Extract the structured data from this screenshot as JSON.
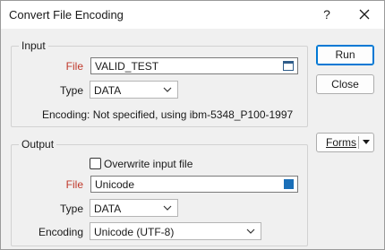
{
  "window": {
    "title": "Convert File Encoding",
    "help_glyph": "?"
  },
  "input_group": {
    "legend": "Input",
    "file_label": "File",
    "file_value": "VALID_TEST",
    "type_label": "Type",
    "type_value": "DATA",
    "encoding_text": "Encoding: Not specified, using ibm-5348_P100-1997"
  },
  "output_group": {
    "legend": "Output",
    "overwrite_label": "Overwrite input file",
    "overwrite_checked": false,
    "file_label": "File",
    "file_value": "Unicode",
    "type_label": "Type",
    "type_value": "DATA",
    "encoding_label": "Encoding",
    "encoding_value": "Unicode (UTF-8)"
  },
  "buttons": {
    "run": "Run",
    "close": "Close",
    "forms": "Forms"
  },
  "colors": {
    "required_label": "#c0392b",
    "accent": "#0078d4"
  }
}
